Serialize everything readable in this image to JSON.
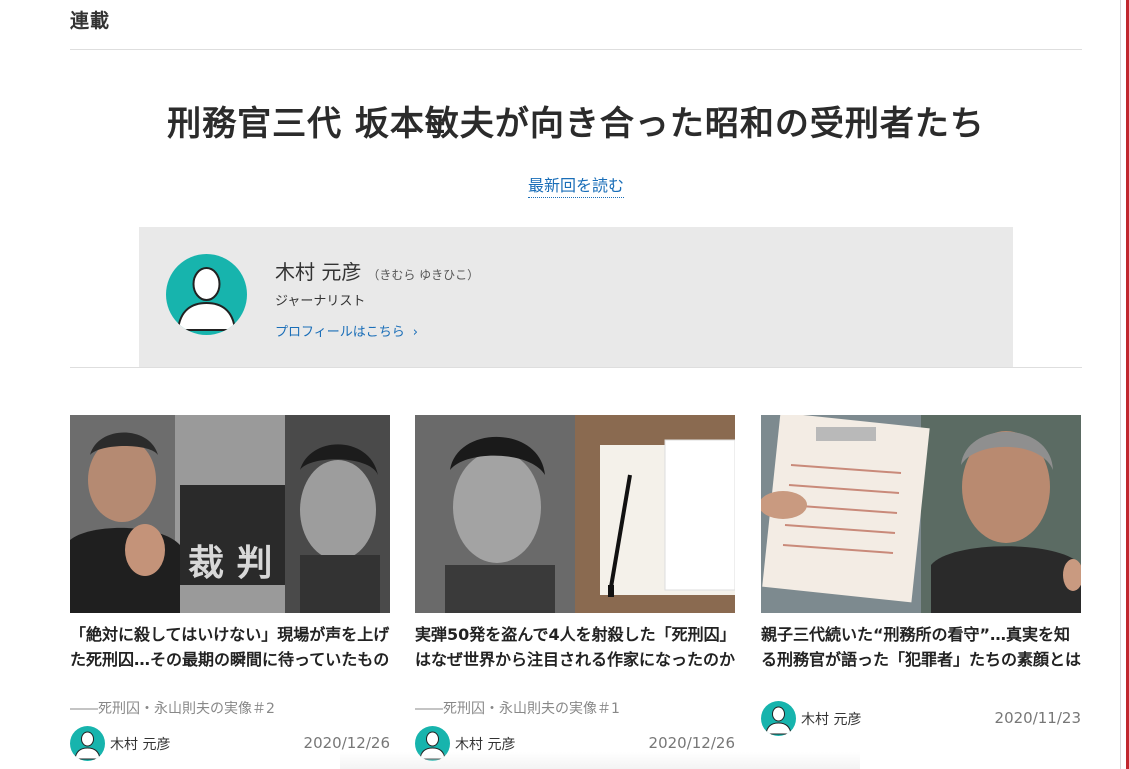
{
  "section": {
    "label": "連載"
  },
  "series": {
    "title": "刑務官三代 坂本敏夫が向き合った昭和の受刑者たち",
    "latest_link": "最新回を読む"
  },
  "author": {
    "name": "木村 元彦",
    "kana": "（きむら ゆきひこ）",
    "role": "ジャーナリスト",
    "profile_link": "プロフィールはこちら",
    "avatar_icon": "person-silhouette-icon",
    "avatar_color": "#17b4ad"
  },
  "articles": [
    {
      "title": "「絶対に殺してはいけない」現場が声を上げた死刑囚…その最期の瞬間に待っていたもの",
      "subtitle": "――死刑囚・永山則夫の実像＃2",
      "author": "木村 元彦",
      "date": "2020/12/26"
    },
    {
      "title": "実弾50発を盗んで4人を射殺した「死刑囚」はなぜ世界から注目される作家になったのか",
      "subtitle": "――死刑囚・永山則夫の実像＃1",
      "author": "木村 元彦",
      "date": "2020/12/26"
    },
    {
      "title": "親子三代続いた“刑務所の看守”…真実を知る刑務官が語った「犯罪者」たちの素顔とは",
      "subtitle": "",
      "author": "木村 元彦",
      "date": "2020/11/23"
    }
  ],
  "colors": {
    "accent": "#1a6eb8",
    "brand_edge": "#c1272d",
    "author_box_bg": "#e9e9e9"
  }
}
